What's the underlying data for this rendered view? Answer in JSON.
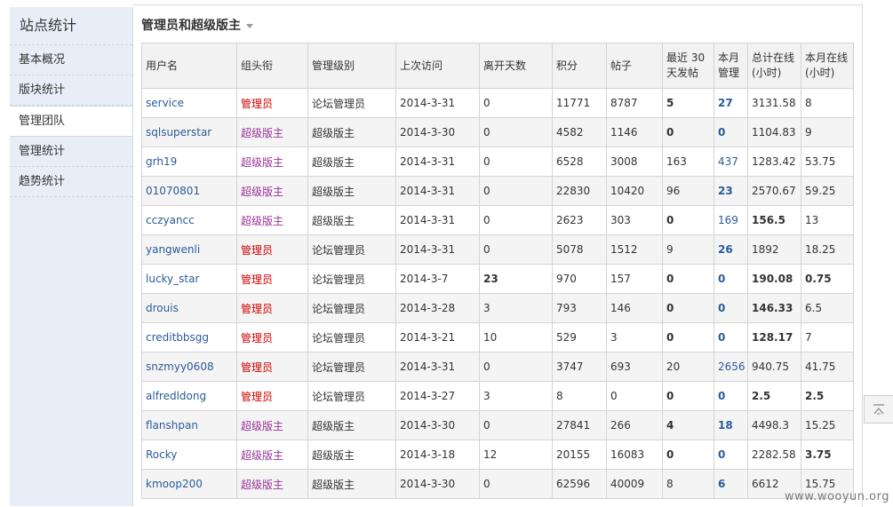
{
  "sidebar": {
    "title": "站点统计",
    "items": [
      {
        "label": "基本概况"
      },
      {
        "label": "版块统计"
      },
      {
        "label": "管理团队"
      },
      {
        "label": "管理统计"
      },
      {
        "label": "趋势统计"
      }
    ],
    "active_index": 2
  },
  "main": {
    "title": "管理员和超级版主"
  },
  "table": {
    "headers": [
      "用户名",
      "组头衔",
      "管理级别",
      "上次访问",
      "离开天数",
      "积分",
      "帖子",
      "最近 30 天发帖",
      "本月管理",
      "总计在线(小时)",
      "本月在线(小时)"
    ],
    "rows": [
      {
        "user": "service",
        "group": "管理员",
        "level": "论坛管理员",
        "last": "2014-3-31",
        "away": "0",
        "credits": "11771",
        "posts": "8787",
        "recent": "5",
        "month_mgr": "27",
        "total_online": "3131.58",
        "month_online": "8"
      },
      {
        "user": "sqlsuperstar",
        "group": "超级版主",
        "level": "超级版主",
        "last": "2014-3-30",
        "away": "0",
        "credits": "4582",
        "posts": "1146",
        "recent": "0",
        "month_mgr": "0",
        "total_online": "1104.83",
        "month_online": "9"
      },
      {
        "user": "grh19",
        "group": "超级版主",
        "level": "超级版主",
        "last": "2014-3-31",
        "away": "0",
        "credits": "6528",
        "posts": "3008",
        "recent": "163",
        "month_mgr": "437",
        "total_online": "1283.42",
        "month_online": "53.75"
      },
      {
        "user": "01070801",
        "group": "超级版主",
        "level": "超级版主",
        "last": "2014-3-31",
        "away": "0",
        "credits": "22830",
        "posts": "10420",
        "recent": "96",
        "month_mgr": "23",
        "total_online": "2570.67",
        "month_online": "59.25"
      },
      {
        "user": "cczyancc",
        "group": "超级版主",
        "level": "超级版主",
        "last": "2014-3-31",
        "away": "0",
        "credits": "2623",
        "posts": "303",
        "recent": "0",
        "month_mgr": "169",
        "total_online": "156.5",
        "month_online": "13"
      },
      {
        "user": "yangwenli",
        "group": "管理员",
        "level": "论坛管理员",
        "last": "2014-3-31",
        "away": "0",
        "credits": "5078",
        "posts": "1512",
        "recent": "9",
        "month_mgr": "26",
        "total_online": "1892",
        "month_online": "18.25"
      },
      {
        "user": "lucky_star",
        "group": "管理员",
        "level": "论坛管理员",
        "last": "2014-3-7",
        "away": "23",
        "credits": "970",
        "posts": "157",
        "recent": "0",
        "month_mgr": "0",
        "total_online": "190.08",
        "month_online": "0.75"
      },
      {
        "user": "drouis",
        "group": "管理员",
        "level": "论坛管理员",
        "last": "2014-3-28",
        "away": "3",
        "credits": "793",
        "posts": "146",
        "recent": "0",
        "month_mgr": "0",
        "total_online": "146.33",
        "month_online": "6.5"
      },
      {
        "user": "creditbbsgg",
        "group": "管理员",
        "level": "论坛管理员",
        "last": "2014-3-21",
        "away": "10",
        "credits": "529",
        "posts": "3",
        "recent": "0",
        "month_mgr": "0",
        "total_online": "128.17",
        "month_online": "7"
      },
      {
        "user": "snzmyy0608",
        "group": "管理员",
        "level": "论坛管理员",
        "last": "2014-3-31",
        "away": "0",
        "credits": "3747",
        "posts": "693",
        "recent": "20",
        "month_mgr": "2656",
        "total_online": "940.75",
        "month_online": "41.75"
      },
      {
        "user": "alfredldong",
        "group": "管理员",
        "level": "论坛管理员",
        "last": "2014-3-27",
        "away": "3",
        "credits": "8",
        "posts": "0",
        "recent": "0",
        "month_mgr": "0",
        "total_online": "2.5",
        "month_online": "2.5"
      },
      {
        "user": "flanshpan",
        "group": "超级版主",
        "level": "超级版主",
        "last": "2014-3-30",
        "away": "0",
        "credits": "27841",
        "posts": "266",
        "recent": "4",
        "month_mgr": "18",
        "total_online": "4498.3",
        "month_online": "15.25"
      },
      {
        "user": "Rocky",
        "group": "超级版主",
        "level": "超级版主",
        "last": "2014-3-18",
        "away": "12",
        "credits": "20155",
        "posts": "16083",
        "recent": "0",
        "month_mgr": "0",
        "total_online": "2282.58",
        "month_online": "3.75"
      },
      {
        "user": "kmoop200",
        "group": "超级版主",
        "level": "超级版主",
        "last": "2014-3-30",
        "away": "0",
        "credits": "62596",
        "posts": "40009",
        "recent": "8",
        "month_mgr": "6",
        "total_online": "6612",
        "month_online": "15.75"
      }
    ]
  },
  "watermark": "www.wooyun.org",
  "colors": {
    "admin": "#cc0000",
    "super_mod": "#993399",
    "link": "#2b5c99",
    "sidebar_bg": "#e8eef7"
  }
}
